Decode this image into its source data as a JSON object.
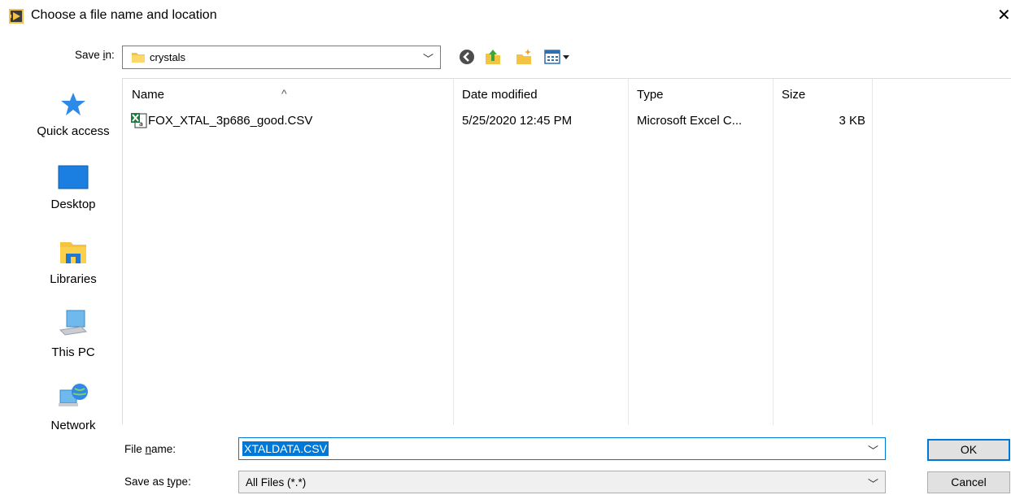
{
  "window": {
    "title": "Choose a file name and location",
    "close_glyph": "✕",
    "icon": "labview-app-icon"
  },
  "save_in": {
    "label_pre": "Save ",
    "label_accel": "i",
    "label_post": "n:",
    "value": "crystals",
    "folder_icon": "folder-icon"
  },
  "toolbar": {
    "icons": [
      "back-icon",
      "up-folder-icon",
      "new-folder-icon",
      "view-menu-icon"
    ]
  },
  "places": [
    {
      "label": "Quick access",
      "icon": "star-icon"
    },
    {
      "label": "Desktop",
      "icon": "desktop-icon"
    },
    {
      "label": "Libraries",
      "icon": "libraries-icon"
    },
    {
      "label": "This PC",
      "icon": "computer-icon"
    },
    {
      "label": "Network",
      "icon": "network-icon"
    }
  ],
  "file_list": {
    "columns": [
      "Name",
      "Date modified",
      "Type",
      "Size"
    ],
    "rows": [
      {
        "name": "FOX_XTAL_3p686_good.CSV",
        "date": "5/25/2020 12:45 PM",
        "type": "Microsoft Excel C...",
        "size": "3 KB",
        "icon": "excel-csv-icon"
      }
    ]
  },
  "file_name": {
    "label_pre": "File ",
    "label_accel": "n",
    "label_post": "ame:",
    "value": "XTALDATA.CSV"
  },
  "save_as_type": {
    "label_pre": "Save as ",
    "label_accel": "t",
    "label_post": "ype:",
    "value": "All Files (*.*)"
  },
  "buttons": {
    "ok": "OK",
    "cancel": "Cancel"
  },
  "colors": {
    "accent": "#0078d7",
    "folder": "#f5c342"
  }
}
